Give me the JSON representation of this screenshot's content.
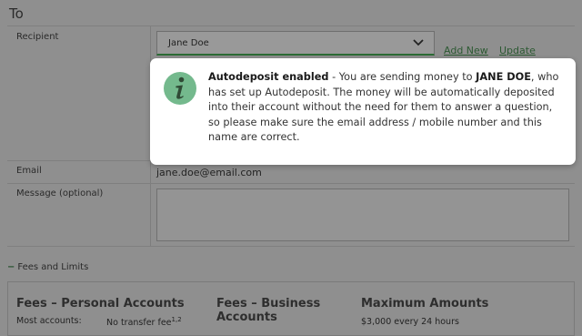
{
  "section_title": "To",
  "recipient": {
    "label": "Recipient",
    "selected": "Jane Doe",
    "add_new_label": "Add New",
    "update_label": "Update"
  },
  "email": {
    "label": "Email",
    "value": "jane.doe@email.com"
  },
  "message": {
    "label": "Message (optional)",
    "value": ""
  },
  "fees_toggle": {
    "symbol": "−",
    "label": "Fees and Limits"
  },
  "fees_panel": {
    "personal_title": "Fees – Personal Accounts",
    "personal_row_label": "Most accounts:",
    "personal_row_value": "No transfer fee",
    "personal_row_sup": "1,2",
    "business_title_line1": "Fees – Business",
    "business_title_line2": "Accounts",
    "max_title": "Maximum Amounts",
    "max_value": "$3,000 every 24 hours"
  },
  "modal": {
    "icon": "info-icon",
    "bold_lead": "Autodeposit enabled",
    "text_1": " - You are sending money to ",
    "recipient_name": "JANE DOE",
    "text_2": ", who has set up Autodeposit. The money will be automatically deposited into their account without the need for them to answer a question, so please make sure the email address / mobile number and this name are correct."
  },
  "colors": {
    "overlay_bg": "#8f8f8f",
    "accent_green": "#2d5a33",
    "icon_circle": "#74b98d",
    "icon_glyph": "#2f4a35",
    "modal_bg": "#ffffff"
  }
}
